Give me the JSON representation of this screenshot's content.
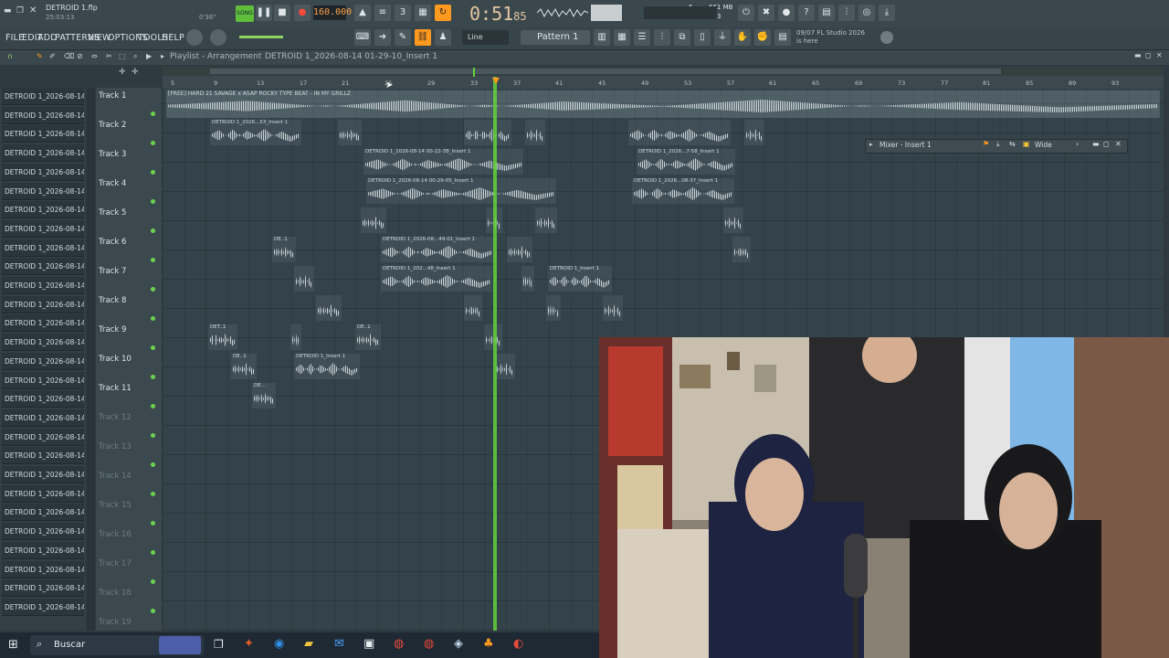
{
  "app": {
    "project_name": "DETROID 1.flp",
    "project_time": "25:03:13",
    "small_time": "0'36\"",
    "tempo": "160.000",
    "song_time": "0:51",
    "song_time_sub": "85",
    "cpu_label": "6",
    "memory": "661 MB",
    "voices": "3",
    "song_mode_label": "SONG"
  },
  "menu": {
    "items": [
      "FILE",
      "EDIT",
      "ADD",
      "PATTERNS",
      "VIEW",
      "OPTIONS",
      "TOOLS",
      "HELP"
    ]
  },
  "toolbar": {
    "snap": "Line",
    "pattern": "Pattern 1",
    "hint_date": "09/07",
    "hint_text": "FL Studio 2026 is here"
  },
  "playlist": {
    "breadcrumb": "Playlist - Arrangement",
    "clip_path": "DETROID 1_2026-08-14 01-29-10_Insert 1",
    "ruler_ticks": [
      "5",
      "9",
      "13",
      "17",
      "21",
      "25",
      "29",
      "33",
      "37",
      "41",
      "45",
      "49",
      "53",
      "57",
      "61",
      "65",
      "69",
      "73",
      "77",
      "81",
      "85",
      "89",
      "93"
    ],
    "track1_clip": "[FREE] HARD 21 SAVAGE x ASAP ROCKY TYPE BEAT - IN MY GRILLZ",
    "tracks": [
      "Track 1",
      "Track 2",
      "Track 3",
      "Track 4",
      "Track 5",
      "Track 6",
      "Track 7",
      "Track 8",
      "Track 9",
      "Track 10",
      "Track 11",
      "Track 12",
      "Track 13",
      "Track 14",
      "Track 15",
      "Track 16",
      "Track 17",
      "Track 18",
      "Track 19"
    ],
    "clip_labels": {
      "t2a": "DETROID 1_2026...53_Insert 1",
      "t3a": "DETROID 1_2026-08-14 00-22-38_Insert 1",
      "t3b": "DETROID 1_2026...7-58_Insert 1",
      "t4a": "DETROID 1_2026-08-14 00-29-05_Insert 1",
      "t4b": "DETROID 1_2026...08-37_Insert 1",
      "t6a": "DE..1",
      "t6b": "DETROID 1_2026-08...49-01_Insert 1",
      "t7a": "DETROID 1_202...48_Insert 1",
      "t7b": "DETROID 1_Insert 1",
      "t9a": "DET..1",
      "t9b": "DE..1",
      "t10a": "DE..1",
      "t10b": "DETROID 1_Insert 1",
      "t11a": "DE..."
    }
  },
  "channels": [
    "DETROID 1_2026-08-14 0...",
    "DETROID 1_2026-08-14 0...",
    "DETROID 1_2026-08-14 0...",
    "DETROID 1_2026-08-14 0...",
    "DETROID 1_2026-08-14 0...",
    "DETROID 1_2026-08-14 0...",
    "DETROID 1_2026-08-14 0...",
    "DETROID 1_2026-08-14 0...",
    "DETROID 1_2026-08-14 0...",
    "DETROID 1_2026-08-14 0...",
    "DETROID 1_2026-08-14 0...",
    "DETROID 1_2026-08-14 0...",
    "DETROID 1_2026-08-14 0...",
    "DETROID 1_2026-08-14 0...",
    "DETROID 1_2026-08-14 0...",
    "DETROID 1_2026-08-14 0...",
    "DETROID 1_2026-08-14 0...",
    "DETROID 1_2026-08-14 0...",
    "DETROID 1_2026-08-14 0...",
    "DETROID 1_2026-08-14 0...",
    "DETROID 1_2026-08-14 0...",
    "DETROID 1_2026-08-14 0...",
    "DETROID 1_2026-08-14 0...",
    "DETROID 1_2026-08-14 0...",
    "DETROID 1_2026-08-14 0...",
    "DETROID 1_2026-08-14 0...",
    "DETROID 1_2026-08-14 0...",
    "DETROID 1_2026-08-14 0..."
  ],
  "mixer": {
    "title": "Mixer - Insert 1",
    "mode": "Wide"
  },
  "taskbar": {
    "search_placeholder": "Buscar"
  }
}
